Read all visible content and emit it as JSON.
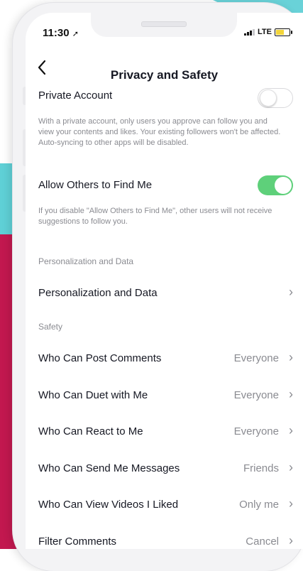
{
  "status_bar": {
    "time": "11:30",
    "network": "LTE",
    "battery_level": 0.6
  },
  "header": {
    "title": "Privacy and Safety"
  },
  "private_account": {
    "label": "Private Account",
    "enabled": false,
    "description": "With a private account, only users you approve can follow you and view your contents and likes. Your existing followers won't be affected. Auto-syncing to other apps will be disabled."
  },
  "find_me": {
    "label": "Allow Others to Find Me",
    "enabled": true,
    "description": "If you disable \"Allow Others to Find Me\", other users will not receive suggestions to follow you."
  },
  "personalization": {
    "section_label": "Personalization and Data",
    "item_label": "Personalization and Data"
  },
  "safety": {
    "section_label": "Safety",
    "items": [
      {
        "label": "Who Can Post Comments",
        "value": "Everyone"
      },
      {
        "label": "Who Can Duet with Me",
        "value": "Everyone"
      },
      {
        "label": "Who Can React to Me",
        "value": "Everyone"
      },
      {
        "label": "Who Can Send Me Messages",
        "value": "Friends"
      },
      {
        "label": "Who Can View Videos I Liked",
        "value": "Only me"
      },
      {
        "label": "Filter Comments",
        "value": "Cancel"
      }
    ]
  },
  "colors": {
    "toggle_on": "#5ed07a",
    "accent_teal": "#69d2d8",
    "accent_red": "#c2184f"
  },
  "icons": {
    "back": "chevron-left-icon",
    "row": "chevron-right-icon"
  }
}
